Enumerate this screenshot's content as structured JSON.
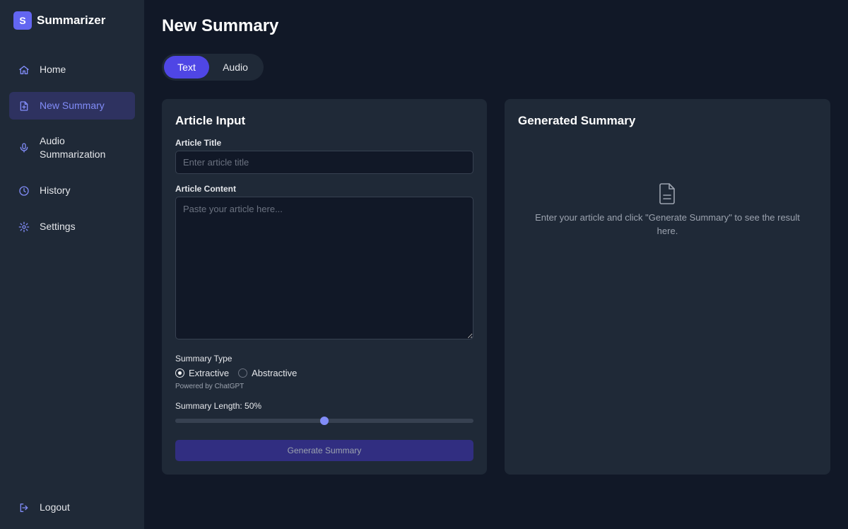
{
  "brand": {
    "logo_letter": "S",
    "name": "Summarizer",
    "accent_color": "#6366f1"
  },
  "sidebar": {
    "items": [
      {
        "label": "Home",
        "icon": "home-icon"
      },
      {
        "label": "New Summary",
        "icon": "file-plus-icon",
        "active": true
      },
      {
        "label": "Audio Summarization",
        "icon": "microphone-icon"
      },
      {
        "label": "History",
        "icon": "clock-icon"
      },
      {
        "label": "Settings",
        "icon": "gear-icon"
      }
    ],
    "logout": {
      "label": "Logout",
      "icon": "logout-icon"
    }
  },
  "page": {
    "title": "New Summary"
  },
  "tabs": [
    {
      "label": "Text",
      "active": true
    },
    {
      "label": "Audio",
      "active": false
    }
  ],
  "input_card": {
    "title": "Article Input",
    "title_field": {
      "label": "Article Title",
      "value": "",
      "placeholder": "Enter article title"
    },
    "content_field": {
      "label": "Article Content",
      "value": "",
      "placeholder": "Paste your article here..."
    },
    "summary_type": {
      "label": "Summary Type",
      "options": [
        {
          "label": "Extractive",
          "checked": true
        },
        {
          "label": "Abstractive",
          "checked": false
        }
      ],
      "note": "Powered by ChatGPT"
    },
    "summary_length": {
      "label": "Summary Length: 50%",
      "value_percent": 50
    },
    "generate_button": "Generate Summary"
  },
  "output_card": {
    "title": "Generated Summary",
    "empty_icon": "document-icon",
    "empty_text": "Enter your article and click \"Generate Summary\" to see the result here."
  }
}
